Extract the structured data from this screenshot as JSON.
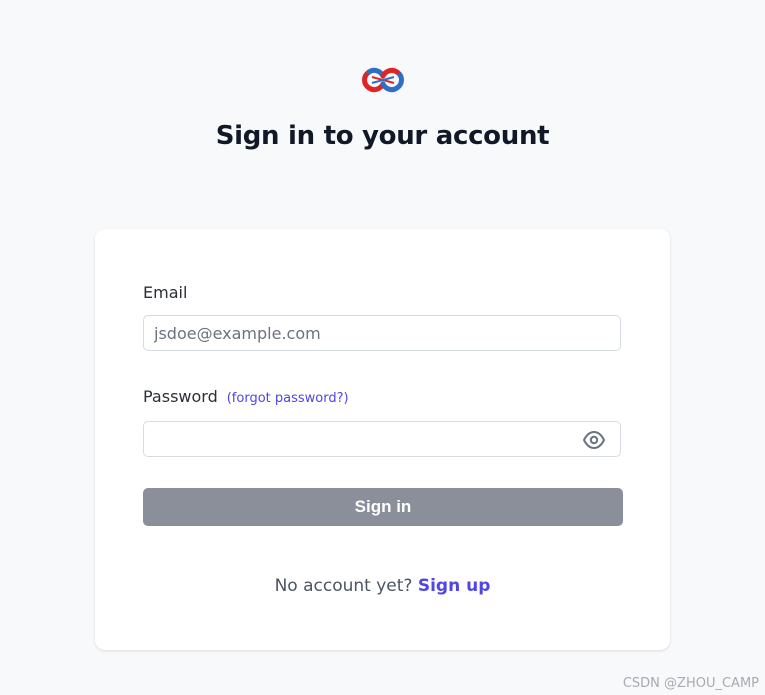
{
  "brand": {
    "logo_icon": "knot-logo-icon"
  },
  "header": {
    "title": "Sign in to your account"
  },
  "form": {
    "email_label": "Email",
    "email_placeholder": "jsdoe@example.com",
    "email_value": "",
    "password_label": "Password",
    "forgot_password_label": "(forgot password?)",
    "password_value": "",
    "show_password_icon": "eye-icon",
    "submit_label": "Sign in"
  },
  "footer": {
    "no_account_text": "No account yet?",
    "signup_label": "Sign up"
  },
  "watermark": {
    "text": "CSDN @ZHOU_CAMP"
  },
  "colors": {
    "background": "#f8f9fb",
    "card": "#ffffff",
    "accent": "#4f46e5",
    "button_disabled": "#8a8f99",
    "logo_red": "#e02424",
    "logo_blue": "#2f6fc3"
  }
}
